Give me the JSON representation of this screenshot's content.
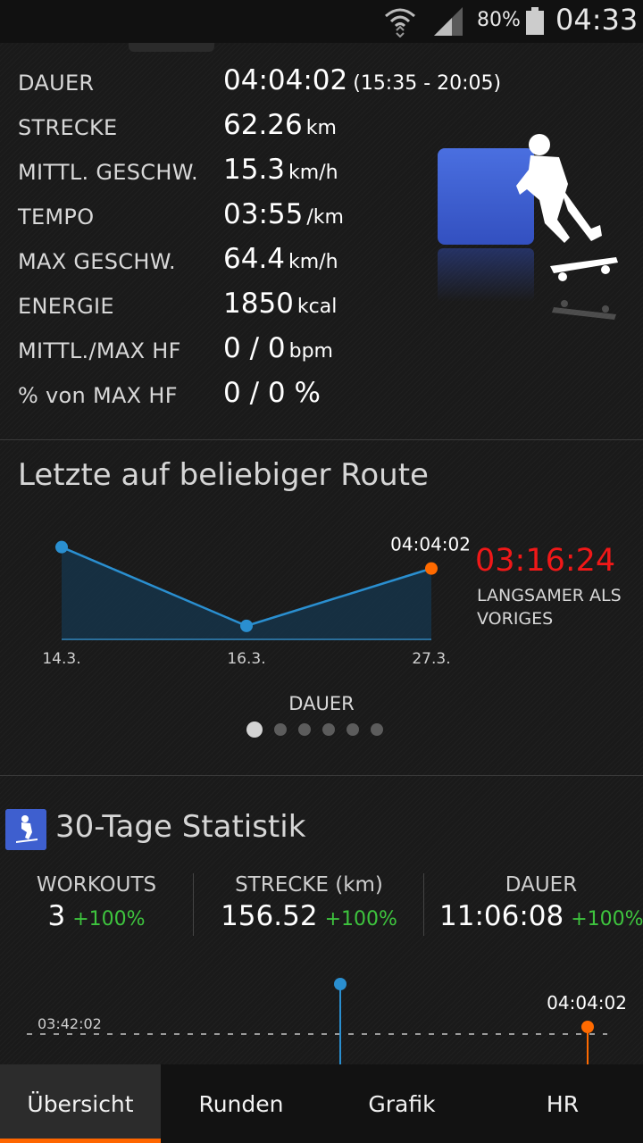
{
  "status_bar": {
    "battery": "80%",
    "time": "04:33"
  },
  "stats": [
    {
      "label": "DAUER",
      "value": "04:04:02",
      "unit": "",
      "sub": "(15:35 - 20:05)"
    },
    {
      "label": "STRECKE",
      "value": "62.26",
      "unit": "km",
      "sub": ""
    },
    {
      "label": "MITTL. GESCHW.",
      "value": "15.3",
      "unit": "km/h",
      "sub": ""
    },
    {
      "label": "TEMPO",
      "value": "03:55",
      "unit": "/km",
      "sub": ""
    },
    {
      "label": "MAX GESCHW.",
      "value": "64.4",
      "unit": "km/h",
      "sub": ""
    },
    {
      "label": "ENERGIE",
      "value": "1850",
      "unit": "kcal",
      "sub": ""
    },
    {
      "label": "MITTL./MAX HF",
      "value": "0 / 0",
      "unit": "bpm",
      "sub": ""
    },
    {
      "label": "% von MAX HF",
      "value": "0 / 0 %",
      "unit": "",
      "sub": ""
    }
  ],
  "route_section": {
    "title": "Letzte auf beliebiger Route",
    "chart_data": {
      "type": "line",
      "categories": [
        "14.3.",
        "16.3.",
        "27.3."
      ],
      "values": [
        0.82,
        0.12,
        0.63
      ],
      "value_label": "04:04:02",
      "caption": "DAUER",
      "series_colors": [
        "#2a8fd0",
        "#2a8fd0",
        "#ff6a00"
      ]
    },
    "difference": "03:16:24",
    "difference_note": "LANGSAMER ALS VORIGES",
    "pages": 6,
    "active_page": 0
  },
  "stats30": {
    "title": "30-Tage Statistik",
    "columns": [
      {
        "header": "WORKOUTS",
        "value": "3",
        "change": "+100%"
      },
      {
        "header": "STRECKE (km)",
        "value": "156.52",
        "change": "+100%"
      },
      {
        "header": "DAUER",
        "value": "11:06:08",
        "change": "+100%"
      }
    ],
    "bottom_chart": {
      "avg_label": "03:42:02",
      "last_label": "04:04:02"
    }
  },
  "tabs": [
    "Übersicht",
    "Runden",
    "Grafik",
    "HR"
  ],
  "colors": {
    "accent": "#ff6600",
    "positive": "#3ec43e",
    "negative": "#f01818",
    "line": "#2a8fd0"
  }
}
